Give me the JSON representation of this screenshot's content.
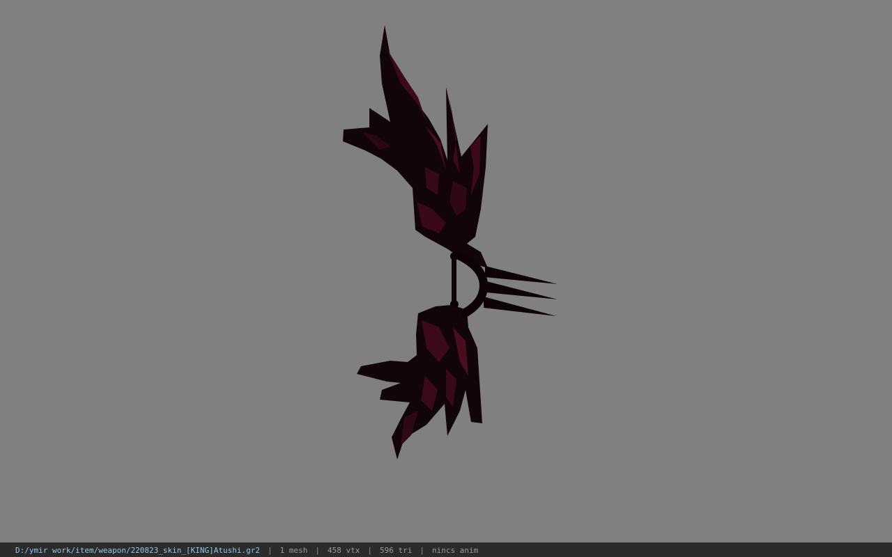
{
  "viewport": {
    "background_color": "#808080",
    "model_base_color": "#120509",
    "model_accent_color": "#4a0d1f"
  },
  "status_bar": {
    "file_path": "D:/ymir work/item/weapon/220823_skin_[KING]Atushi.gr2",
    "separator": "|",
    "mesh_count": "1 mesh",
    "vertex_count": "458 vtx",
    "triangle_count": "596 tri",
    "anim_status": "nincs anim"
  }
}
